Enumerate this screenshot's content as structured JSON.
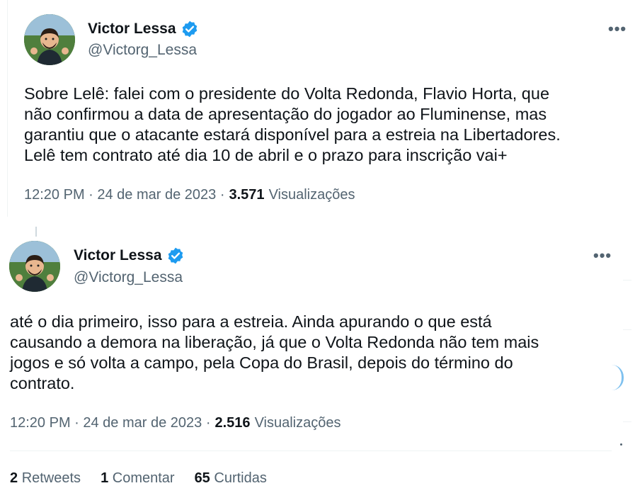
{
  "tweets": [
    {
      "author_name": "Victor Lessa",
      "handle": "@Victorg_Lessa",
      "more_label": "•••",
      "text": "Sobre Lelê: falei com o presidente do Volta Redonda, Flavio Horta, que\nnão confirmou a data de apresentação do jogador ao Fluminense, mas\ngarantiu que o atacante estará disponível para a estreia na Libertadores.\nLelê tem contrato até dia 10 de abril e o prazo para inscrição vai+",
      "time": "12:20 PM · 24 de mar de 2023 ·",
      "views_count": "3.571",
      "views_label": "Visualizações"
    },
    {
      "author_name": "Victor Lessa",
      "handle": "@Victorg_Lessa",
      "more_label": "•••",
      "text": "até o dia primeiro, isso para a estreia. Ainda apurando o que está\ncausando a demora na liberação, já que o Volta Redonda não tem mais\njogos e só volta a campo, pela Copa do Brasil, depois do término do\ncontrato.",
      "time": "12:20 PM · 24 de mar de 2023 ·",
      "views_count": "2.516",
      "views_label": "Visualizações"
    }
  ],
  "stats": {
    "retweets_count": "2",
    "retweets_label": "Retweets",
    "comments_count": "1",
    "comments_label": "Comentar",
    "likes_count": "65",
    "likes_label": "Curtidas"
  },
  "colors": {
    "verified": "#1d9bf0",
    "secondary_text": "#536471",
    "primary_text": "#0f1419"
  },
  "icons": [
    "verified-badge-icon",
    "more-options-icon"
  ]
}
